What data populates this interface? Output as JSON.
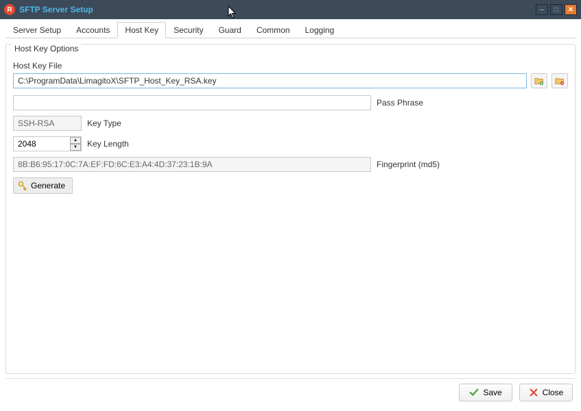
{
  "window": {
    "title": "SFTP Server Setup",
    "app_icon_letter": "R"
  },
  "tabs": [
    {
      "label": "Server Setup",
      "active": false
    },
    {
      "label": "Accounts",
      "active": false
    },
    {
      "label": "Host Key",
      "active": true
    },
    {
      "label": "Security",
      "active": false
    },
    {
      "label": "Guard",
      "active": false
    },
    {
      "label": "Common",
      "active": false
    },
    {
      "label": "Logging",
      "active": false
    }
  ],
  "group": {
    "title": "Host Key Options",
    "host_key_file_label": "Host Key File",
    "host_key_file_value": "C:\\ProgramData\\LimagitoX\\SFTP_Host_Key_RSA.key",
    "pass_phrase_label": "Pass Phrase",
    "pass_phrase_value": "",
    "key_type_label": "Key Type",
    "key_type_value": "SSH-RSA",
    "key_length_label": "Key Length",
    "key_length_value": "2048",
    "fingerprint_label": "Fingerprint (md5)",
    "fingerprint_value": "8B:B6:95:17:0C:7A:EF:FD:6C:E3:A4:4D:37:23:1B:9A",
    "generate_label": "Generate"
  },
  "footer": {
    "save_label": "Save",
    "close_label": "Close"
  }
}
